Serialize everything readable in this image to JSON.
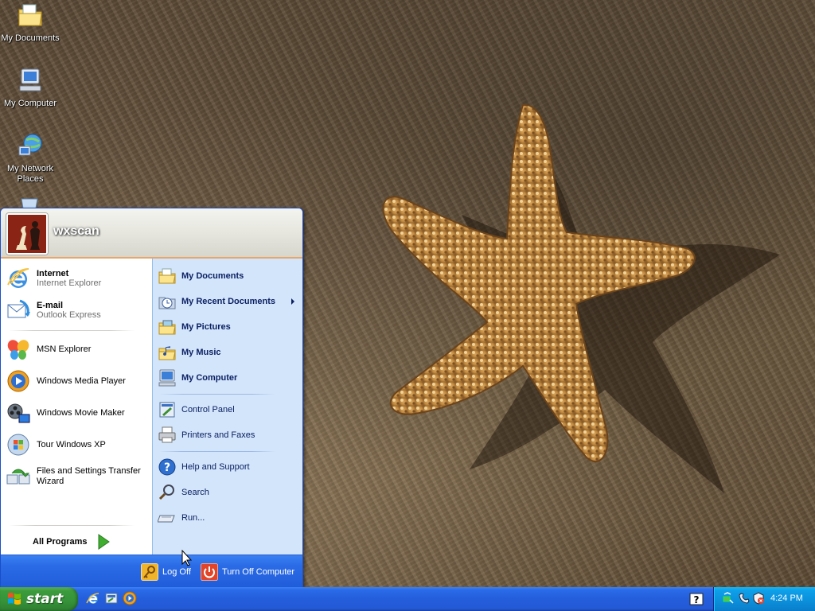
{
  "desktop": {
    "icons": [
      {
        "label": "My Documents",
        "icon": "my-documents-folder-icon"
      },
      {
        "label": "My Computer",
        "icon": "my-computer-icon"
      },
      {
        "label": "My Network Places",
        "icon": "network-places-icon"
      }
    ],
    "wallpaper": "starfish-on-sand"
  },
  "start_menu": {
    "username": "wxscan",
    "left": {
      "pinned": [
        {
          "title": "Internet",
          "subtitle": "Internet Explorer",
          "icon": "internet-explorer-icon"
        },
        {
          "title": "E-mail",
          "subtitle": "Outlook Express",
          "icon": "outlook-express-icon"
        }
      ],
      "recent": [
        {
          "label": "MSN Explorer",
          "icon": "msn-butterfly-icon"
        },
        {
          "label": "Windows Media Player",
          "icon": "media-player-icon"
        },
        {
          "label": "Windows Movie Maker",
          "icon": "movie-maker-icon"
        },
        {
          "label": "Tour Windows XP",
          "icon": "tour-xp-icon"
        },
        {
          "label": "Files and Settings Transfer Wizard",
          "icon": "transfer-wizard-icon"
        }
      ],
      "all_programs": "All Programs"
    },
    "right": {
      "places": [
        {
          "label": "My Documents",
          "icon": "folder-icon"
        },
        {
          "label": "My Recent Documents",
          "icon": "recent-documents-icon",
          "submenu": true
        },
        {
          "label": "My Pictures",
          "icon": "pictures-folder-icon"
        },
        {
          "label": "My Music",
          "icon": "music-folder-icon"
        },
        {
          "label": "My Computer",
          "icon": "computer-icon"
        }
      ],
      "settings": [
        {
          "label": "Control Panel",
          "icon": "control-panel-icon"
        },
        {
          "label": "Printers and Faxes",
          "icon": "printer-icon"
        }
      ],
      "tools": [
        {
          "label": "Help and Support",
          "icon": "help-icon"
        },
        {
          "label": "Search",
          "icon": "search-icon"
        },
        {
          "label": "Run...",
          "icon": "run-icon"
        }
      ]
    },
    "footer": {
      "log_off": "Log Off",
      "turn_off": "Turn Off Computer"
    }
  },
  "taskbar": {
    "start_label": "start",
    "quick_launch": [
      "internet-explorer-icon",
      "show-desktop-icon",
      "media-player-icon"
    ],
    "tray_icons": [
      "help-icon",
      "network-icon",
      "phone-connection-icon",
      "security-alert-icon"
    ],
    "clock": "4:24 PM"
  },
  "colors": {
    "taskbar_blue": "#245edb",
    "start_green": "#3c9c3c",
    "menu_right_pane": "#d3e5fa",
    "menu_text_blue": "#0c2164",
    "tray_blue": "#0b8fda"
  }
}
